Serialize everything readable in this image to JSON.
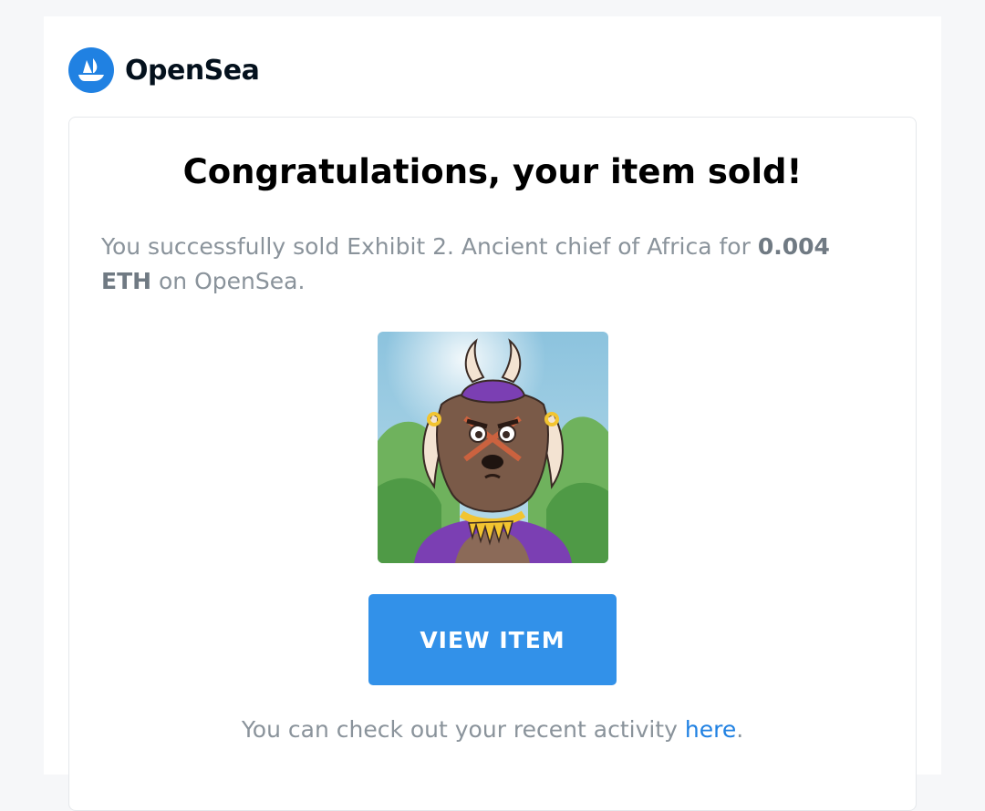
{
  "brand": {
    "name": "OpenSea",
    "logo_icon": "opensea-ship-icon",
    "logo_color": "#2081e2"
  },
  "card": {
    "title": "Congratulations, your item sold!",
    "message": {
      "prefix": "You successfully sold Exhibit 2. Ancient chief of Africa for ",
      "price": "0.004 ETH",
      "suffix": " on OpenSea."
    },
    "nft_image": {
      "icon": "nft-artwork-horned-chief",
      "description_colors": {
        "sky": "#7fb7d6",
        "foliage": "#5ea453",
        "fur": "#7a5a48",
        "headwrap": "#7b3fb3",
        "horns": "#f3e3d2"
      }
    },
    "button_label": "VIEW ITEM",
    "button_color": "#3291e9",
    "footer": {
      "text": "You can check out your recent activity ",
      "link_text": "here",
      "end": "."
    }
  }
}
